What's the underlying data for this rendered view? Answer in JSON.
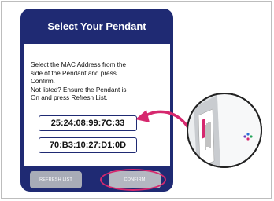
{
  "dialog": {
    "title": "Select Your Pendant",
    "instructions": "Select the MAC Address from the\nside of the Pendant and press\nConfirm.\nNot listed? Ensure the Pendant is\n On and press Refresh List.",
    "mac_addresses": [
      "25:24:08:99:7C:33",
      "70:B3:10:27:D1:0D"
    ],
    "refresh_label": "REFRESH LIST",
    "confirm_label": "CONFIRM"
  },
  "colors": {
    "dialog_bg": "#1f2a73",
    "highlight": "#d6286e",
    "button_bg": "#a8acb7"
  },
  "icons": [
    "pendant-device-zoom",
    "curved-arrow-icon"
  ]
}
